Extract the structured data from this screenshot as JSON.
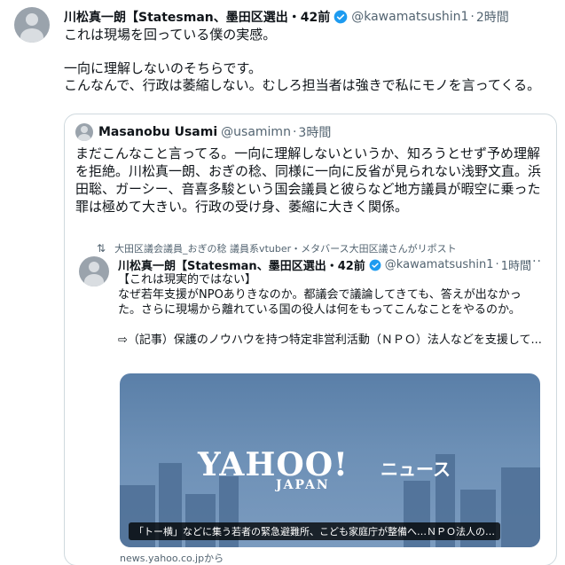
{
  "main": {
    "name": "川松真一朗【Statesman、墨田区選出・42前",
    "handle": "@kawamatsushin1",
    "time": "2時間",
    "text_1": "これは現場を回っている僕の実感。",
    "text_2": "一向に理解しないのそちらです。\nこんなんで、行政は萎縮しない。むしろ担当者は強きで私にモノを言ってくる。"
  },
  "quote": {
    "name": "Masanobu Usami",
    "handle": "@usamimn",
    "time": "3時間",
    "text": "まだこんなこと言ってる。一向に理解しないというか、知ろうとせず予め理解を拒絶。川松真一朗、おぎの稔、同様に一向に反省が見られない浅野文直。浜田聡、ガーシー、音喜多駿という国会議員と彼らなど地方議員が暇空に乗った罪は極めて大きい。行政の受け身、萎縮に大きく関係。"
  },
  "retweet": {
    "label": "大田区議会議員_おぎの稔 議員系vtuber・メタバース大田区議さんがリポスト"
  },
  "inner": {
    "name": "川松真一朗【Statesman、墨田区選出・42前",
    "handle": "@kawamatsushin1",
    "time": "1時間",
    "more": "···",
    "text": "【これは現実的ではない】\nなぜ若年支援がNPOありきなのか。都議会で議論してきても、答えが出なかった。さらに現場から離れている国の役人は何をもってこんなことをやるのか。\n\n⇨（記事）保護のノウハウを持つ特定非営利活動（ＮＰＯ）法人などを支援して..."
  },
  "card": {
    "logo": "YAHOO!",
    "logo_sub": "JAPAN",
    "logo_news": "ニュース",
    "caption": "「トー横」などに集う若者の緊急避難所、こども家庭庁が整備へ…ＮＰＯ法人の…",
    "source": "news.yahoo.co.jpから"
  },
  "colors": {
    "verified": "#1d9bf0",
    "muted": "#536471",
    "border": "#cfd9de"
  },
  "icons": {
    "verified": "verified-badge-icon",
    "retweet": "retweet-icon",
    "more": "more-options-icon"
  }
}
